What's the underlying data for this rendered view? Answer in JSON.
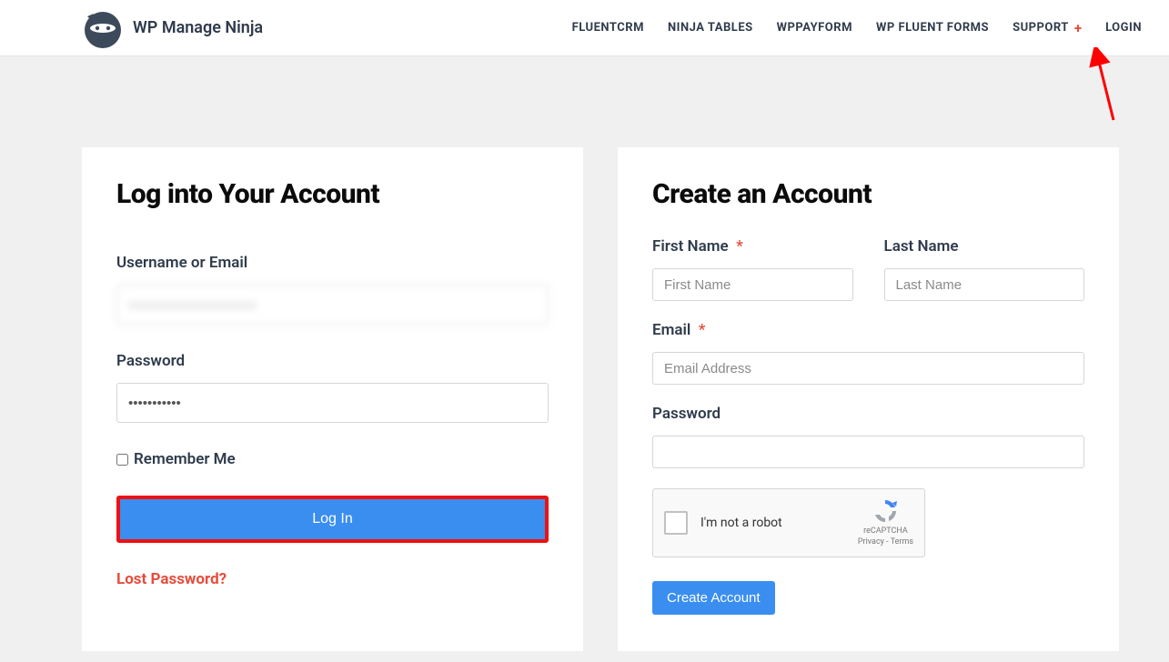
{
  "brand": {
    "name": "WP Manage Ninja"
  },
  "nav": {
    "items": [
      "FLUENTCRM",
      "NINJA TABLES",
      "WPPAYFORM",
      "WP FLUENT FORMS",
      "SUPPORT",
      "LOGIN"
    ],
    "plus": "+"
  },
  "login": {
    "title": "Log into Your Account",
    "username_label": "Username or Email",
    "username_value": "xxxxxxxxxxxxxxxxxxx",
    "password_label": "Password",
    "password_value": "•••••••••••",
    "remember_label": "Remember Me",
    "button_label": "Log In",
    "lost_password": "Lost Password?"
  },
  "register": {
    "title": "Create an Account",
    "first_name_label": "First Name",
    "first_name_placeholder": "First Name",
    "last_name_label": "Last Name",
    "last_name_placeholder": "Last Name",
    "email_label": "Email",
    "email_placeholder": "Email Address",
    "password_label": "Password",
    "captcha_label": "I'm not a robot",
    "captcha_brand": "reCAPTCHA",
    "captcha_terms": "Privacy - Terms",
    "button_label": "Create Account",
    "required_mark": "*"
  }
}
